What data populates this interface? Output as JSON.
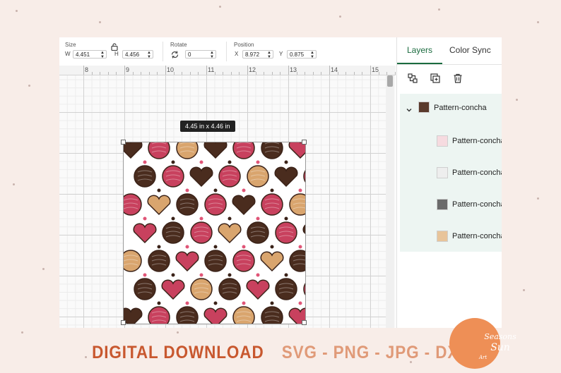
{
  "toolbar": {
    "size_label": "Size",
    "w_label": "W",
    "w_value": "4.451",
    "h_label": "H",
    "h_value": "4.456",
    "rotate_label": "Rotate",
    "rotate_value": "0",
    "position_label": "Position",
    "x_label": "X",
    "x_value": "8.972",
    "y_label": "Y",
    "y_value": "0.875",
    "lock_icon": "lock-icon",
    "rotate_icon": "rotate-icon"
  },
  "ruler": {
    "ticks": [
      "8",
      "9",
      "10",
      "11",
      "12",
      "13",
      "14",
      "15"
    ]
  },
  "canvas": {
    "size_tooltip": "4.45  in x 4.46  in"
  },
  "panel": {
    "tabs": [
      "Layers",
      "Color Sync"
    ],
    "active_tab": "Layers",
    "actions": [
      "ungroup-icon",
      "duplicate-icon",
      "delete-icon"
    ],
    "group": {
      "name": "Pattern-concha",
      "expanded": true
    },
    "layers": [
      {
        "name": "Pattern-concha",
        "icon": "pattern-thumbnail-pink-icon"
      },
      {
        "name": "Pattern-concha",
        "icon": "pattern-thumbnail-light-icon"
      },
      {
        "name": "Pattern-concha",
        "icon": "pattern-thumbnail-dark-icon"
      },
      {
        "name": "Pattern-concha",
        "icon": "pattern-thumbnail-tan-icon"
      }
    ]
  },
  "footer": {
    "primary": "DIGITAL DOWNLOAD",
    "formats": "SVG - PNG - JPG - DXF"
  },
  "logo": {
    "line1": "Seasons",
    "line2": "Sun",
    "line3": "Art"
  },
  "colors": {
    "accent": "#1b6b3f",
    "background": "#f8ede8",
    "footer_primary": "#c8582f",
    "footer_secondary": "#e09a78",
    "logo": "#ee8f56",
    "concha_pink": "#c8415e",
    "concha_dark": "#4a2c1e",
    "concha_tan": "#d9a56e"
  }
}
